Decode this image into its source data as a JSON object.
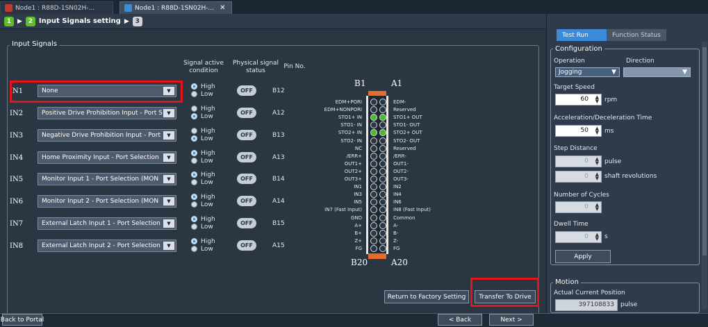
{
  "tabs": [
    {
      "label": "Node1 : R88D-1SN02H-..."
    },
    {
      "label": "Node1 : R88D-1SN02H-...",
      "close": "✕"
    }
  ],
  "steps": {
    "step1": "1",
    "step2": "2",
    "label": "Input Signals setting",
    "step3": "3"
  },
  "input_signals": {
    "title": "Input Signals",
    "headers": {
      "active": "Signal active condition",
      "physical": "Physical signal status",
      "pin": "Pin No."
    },
    "rows": [
      {
        "name": "IN1",
        "function": "None",
        "active": "high",
        "status": "OFF",
        "pin": "B12"
      },
      {
        "name": "IN2",
        "function": "Positive Drive Prohibition Input - Port Selection",
        "active": "low",
        "status": "OFF",
        "pin": "A12"
      },
      {
        "name": "IN3",
        "function": "Negative Drive Prohibition Input - Port Selection",
        "active": "low",
        "status": "OFF",
        "pin": "B13"
      },
      {
        "name": "IN4",
        "function": "Home Proximity Input - Port Selection",
        "active": "high",
        "status": "OFF",
        "pin": "A13"
      },
      {
        "name": "IN5",
        "function": "Monitor Input 1 - Port Selection (MON",
        "active": "high",
        "status": "OFF",
        "pin": "B14"
      },
      {
        "name": "IN6",
        "function": "Monitor Input 2 - Port Selection (MON",
        "active": "high",
        "status": "OFF",
        "pin": "A14"
      },
      {
        "name": "IN7",
        "function": "External Latch Input 1 - Port Selection",
        "active": "high",
        "status": "OFF",
        "pin": "B15"
      },
      {
        "name": "IN8",
        "function": "External Latch Input 2 - Port Selection",
        "active": "high",
        "status": "OFF",
        "pin": "A15"
      }
    ],
    "radio_high": "High",
    "radio_low": "Low"
  },
  "connector": {
    "b1": "B1",
    "a1": "A1",
    "b20": "B20",
    "a20": "A20",
    "left_labels": [
      "EDM+PORI",
      "EDM+NONPORI",
      "STO1+ IN",
      "STO1- IN",
      "STO2+ IN",
      "STO2- IN",
      "NC",
      "/ERR+",
      "OUT1+",
      "OUT2+",
      "OUT3+",
      "IN1",
      "IN3",
      "IN5",
      "IN7 (Fast Input)",
      "GND",
      "A+",
      "B+",
      "Z+",
      "FG"
    ],
    "right_labels": [
      "EDM-",
      "Reserved",
      "STO1+ OUT",
      "STO1- OUT",
      "STO2+ OUT",
      "STO2- OUT",
      "Reserved",
      "/ERR-",
      "OUT1-",
      "OUT2-",
      "OUT3-",
      "IN2",
      "IN4",
      "IN6",
      "IN8 (Fast Input)",
      "Common",
      "A-",
      "B-",
      "Z-",
      "FG"
    ]
  },
  "buttons": {
    "factory": "Return to Factory Setting",
    "transfer": "Transfer To Drive",
    "back_portal": "Back to Portal",
    "back": "< Back",
    "next": "Next >"
  },
  "right_panel": {
    "tab_test_run": "Test Run",
    "tab_function_status": "Function Status",
    "configuration": "Configuration",
    "operation_label": "Operation",
    "direction_label": "Direction",
    "operation_value": "Jogging",
    "target_speed_label": "Target Speed",
    "target_speed_value": "60",
    "target_speed_unit": "rpm",
    "accel_label": "Acceleration/Deceleration Time",
    "accel_value": "50",
    "accel_unit": "ms",
    "step_distance_label": "Step Distance",
    "step_pulse_value": "0",
    "step_pulse_unit": "pulse",
    "step_rev_value": "0",
    "step_rev_unit": "shaft revolutions",
    "cycles_label": "Number of Cycles",
    "cycles_value": "0",
    "dwell_label": "Dwell Time",
    "dwell_value": "0",
    "dwell_unit": "s",
    "apply": "Apply",
    "motion": "Motion",
    "actual_pos_label": "Actual Current Position",
    "actual_pos_value": "397108833",
    "actual_pos_unit": "pulse"
  },
  "colors": {
    "accent": "#3b8bd9",
    "highlight": "#e5141a",
    "connector_active": "#4cb82d"
  }
}
